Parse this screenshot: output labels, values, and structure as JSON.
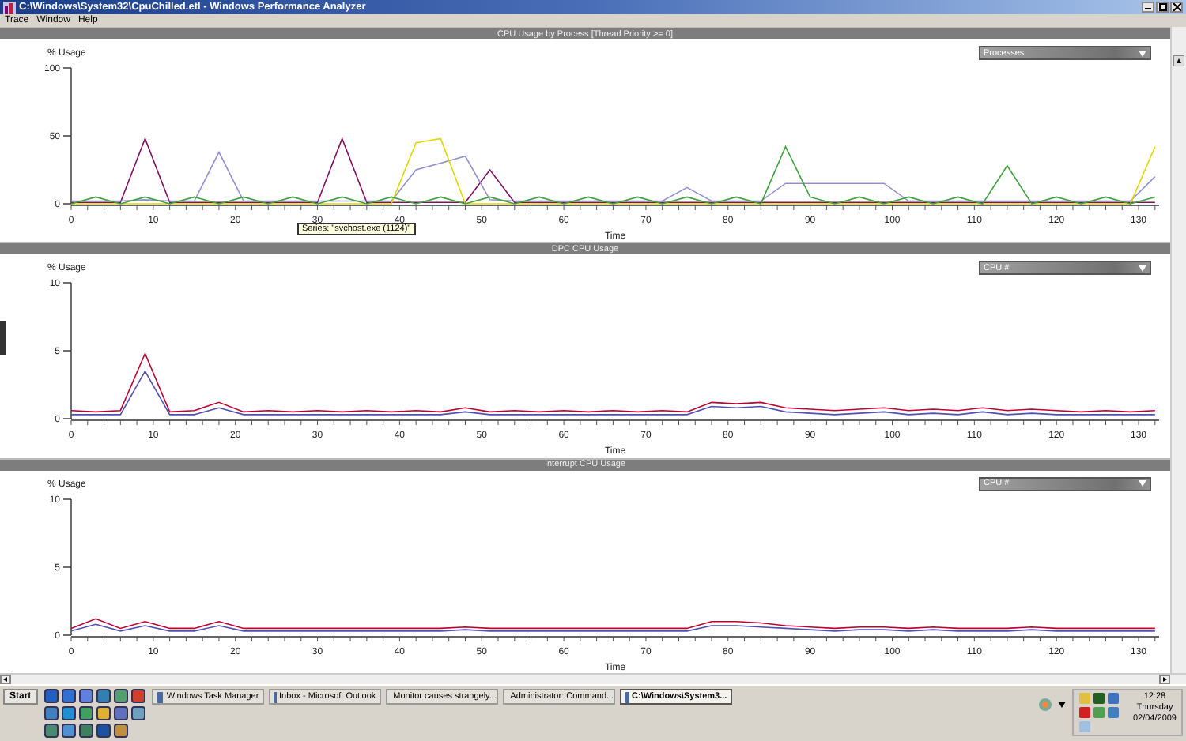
{
  "window": {
    "title": "C:\\Windows\\System32\\CpuChilled.etl - Windows Performance Analyzer"
  },
  "menu": [
    "Trace",
    "Window",
    "Help"
  ],
  "panels": [
    {
      "title": "CPU Usage by Process [Thread Priority >= 0]",
      "dropdown": "Processes",
      "tooltip": "Series: \"svchost.exe (1124)\"",
      "chart_data": {
        "type": "line",
        "xlabel": "Time",
        "ylabel": "% Usage",
        "x": [
          0,
          3,
          6,
          9,
          12,
          15,
          18,
          21,
          24,
          27,
          30,
          33,
          36,
          39,
          42,
          45,
          48,
          51,
          54,
          57,
          60,
          63,
          66,
          69,
          72,
          75,
          78,
          81,
          84,
          87,
          90,
          93,
          96,
          99,
          102,
          105,
          108,
          111,
          114,
          117,
          120,
          123,
          126,
          129,
          132
        ],
        "xlim": [
          0,
          132.5
        ],
        "ylim": [
          0,
          100
        ],
        "xticks": [
          0,
          10,
          20,
          30,
          40,
          50,
          60,
          70,
          80,
          90,
          100,
          110,
          120,
          130
        ],
        "yticks": [
          0,
          50,
          100
        ],
        "series": [
          {
            "color": "#801060",
            "values": [
              1,
              1,
              1,
              48,
              1,
              1,
              1,
              1,
              1,
              1,
              1,
              48,
              1,
              1,
              1,
              1,
              1,
              25,
              1,
              1,
              1,
              1,
              1,
              1,
              1,
              1,
              1,
              1,
              1,
              1,
              1,
              1,
              1,
              1,
              1,
              1,
              1,
              1,
              1,
              1,
              1,
              1,
              1,
              1,
              1
            ]
          },
          {
            "color": "#9090d0",
            "values": [
              2,
              2,
              2,
              3,
              2,
              2,
              38,
              2,
              2,
              2,
              2,
              2,
              2,
              2,
              25,
              30,
              35,
              3,
              2,
              2,
              2,
              2,
              2,
              2,
              2,
              12,
              2,
              2,
              2,
              15,
              15,
              15,
              15,
              15,
              2,
              2,
              2,
              2,
              2,
              2,
              2,
              2,
              2,
              2,
              20
            ]
          },
          {
            "color": "#e0d800",
            "values": [
              0,
              0,
              0,
              0,
              0,
              0,
              0,
              0,
              0,
              0,
              0,
              0,
              0,
              0,
              45,
              48,
              0,
              0,
              0,
              0,
              0,
              0,
              0,
              0,
              0,
              0,
              0,
              0,
              0,
              0,
              0,
              0,
              0,
              0,
              0,
              0,
              0,
              0,
              0,
              0,
              0,
              0,
              0,
              0,
              42
            ]
          },
          {
            "color": "#40a040",
            "values": [
              0,
              5,
              0,
              5,
              0,
              5,
              0,
              5,
              0,
              5,
              0,
              5,
              0,
              5,
              0,
              5,
              0,
              5,
              0,
              5,
              0,
              5,
              0,
              5,
              0,
              5,
              0,
              5,
              0,
              42,
              5,
              0,
              5,
              0,
              5,
              0,
              5,
              0,
              28,
              0,
              5,
              0,
              5,
              0,
              5
            ]
          }
        ]
      }
    },
    {
      "title": "DPC CPU Usage",
      "dropdown": "CPU #",
      "chart_data": {
        "type": "line",
        "xlabel": "Time",
        "ylabel": "% Usage",
        "x": [
          0,
          3,
          6,
          9,
          12,
          15,
          18,
          21,
          24,
          27,
          30,
          33,
          36,
          39,
          42,
          45,
          48,
          51,
          54,
          57,
          60,
          63,
          66,
          69,
          72,
          75,
          78,
          81,
          84,
          87,
          90,
          93,
          96,
          99,
          102,
          105,
          108,
          111,
          114,
          117,
          120,
          123,
          126,
          129,
          132
        ],
        "xlim": [
          0,
          132.5
        ],
        "ylim": [
          0,
          10
        ],
        "xticks": [
          0,
          10,
          20,
          30,
          40,
          50,
          60,
          70,
          80,
          90,
          100,
          110,
          120,
          130
        ],
        "yticks": [
          0,
          5,
          10
        ],
        "series": [
          {
            "color": "#c00030",
            "values": [
              0.6,
              0.5,
              0.6,
              4.8,
              0.5,
              0.6,
              1.2,
              0.5,
              0.6,
              0.5,
              0.6,
              0.5,
              0.6,
              0.5,
              0.6,
              0.5,
              0.8,
              0.5,
              0.6,
              0.5,
              0.6,
              0.5,
              0.6,
              0.5,
              0.6,
              0.5,
              1.2,
              1.1,
              1.2,
              0.8,
              0.7,
              0.6,
              0.7,
              0.8,
              0.6,
              0.7,
              0.6,
              0.8,
              0.6,
              0.7,
              0.6,
              0.5,
              0.6,
              0.5,
              0.6
            ]
          },
          {
            "color": "#5050b0",
            "values": [
              0.3,
              0.3,
              0.3,
              3.5,
              0.3,
              0.3,
              0.8,
              0.3,
              0.3,
              0.3,
              0.3,
              0.3,
              0.3,
              0.3,
              0.3,
              0.3,
              0.5,
              0.3,
              0.3,
              0.3,
              0.3,
              0.3,
              0.3,
              0.3,
              0.3,
              0.3,
              0.9,
              0.8,
              0.9,
              0.5,
              0.4,
              0.3,
              0.4,
              0.5,
              0.3,
              0.4,
              0.3,
              0.5,
              0.3,
              0.4,
              0.3,
              0.3,
              0.3,
              0.3,
              0.3
            ]
          }
        ]
      }
    },
    {
      "title": "Interrupt CPU Usage",
      "dropdown": "CPU #",
      "chart_data": {
        "type": "line",
        "xlabel": "Time",
        "ylabel": "% Usage",
        "x": [
          0,
          3,
          6,
          9,
          12,
          15,
          18,
          21,
          24,
          27,
          30,
          33,
          36,
          39,
          42,
          45,
          48,
          51,
          54,
          57,
          60,
          63,
          66,
          69,
          72,
          75,
          78,
          81,
          84,
          87,
          90,
          93,
          96,
          99,
          102,
          105,
          108,
          111,
          114,
          117,
          120,
          123,
          126,
          129,
          132
        ],
        "xlim": [
          0,
          132.5
        ],
        "ylim": [
          0,
          10
        ],
        "xticks": [
          0,
          10,
          20,
          30,
          40,
          50,
          60,
          70,
          80,
          90,
          100,
          110,
          120,
          130
        ],
        "yticks": [
          0,
          5,
          10
        ],
        "series": [
          {
            "color": "#c00030",
            "values": [
              0.5,
              1.2,
              0.5,
              1.0,
              0.5,
              0.5,
              1.0,
              0.5,
              0.5,
              0.5,
              0.5,
              0.5,
              0.5,
              0.5,
              0.5,
              0.5,
              0.6,
              0.5,
              0.5,
              0.5,
              0.5,
              0.5,
              0.5,
              0.5,
              0.5,
              0.5,
              1.0,
              1.0,
              0.9,
              0.7,
              0.6,
              0.5,
              0.6,
              0.6,
              0.5,
              0.6,
              0.5,
              0.5,
              0.5,
              0.6,
              0.5,
              0.5,
              0.5,
              0.5,
              0.5
            ]
          },
          {
            "color": "#5050b0",
            "values": [
              0.3,
              0.8,
              0.3,
              0.7,
              0.3,
              0.3,
              0.7,
              0.3,
              0.3,
              0.3,
              0.3,
              0.3,
              0.3,
              0.3,
              0.3,
              0.3,
              0.4,
              0.3,
              0.3,
              0.3,
              0.3,
              0.3,
              0.3,
              0.3,
              0.3,
              0.3,
              0.7,
              0.7,
              0.6,
              0.5,
              0.4,
              0.3,
              0.4,
              0.4,
              0.3,
              0.4,
              0.3,
              0.3,
              0.3,
              0.4,
              0.3,
              0.3,
              0.3,
              0.3,
              0.3
            ]
          }
        ]
      }
    }
  ],
  "taskbar": {
    "start": "Start",
    "tasks": [
      {
        "label": "Windows Task Manager",
        "selected": false
      },
      {
        "label": "Inbox - Microsoft Outlook",
        "selected": false
      },
      {
        "label": "Monitor causes strangely...",
        "selected": false
      },
      {
        "label": "Administrator: Command...",
        "selected": false
      },
      {
        "label": "C:\\Windows\\System3...",
        "selected": true
      }
    ],
    "clock": {
      "time": "12:28",
      "day": "Thursday",
      "date": "02/04/2009"
    }
  }
}
